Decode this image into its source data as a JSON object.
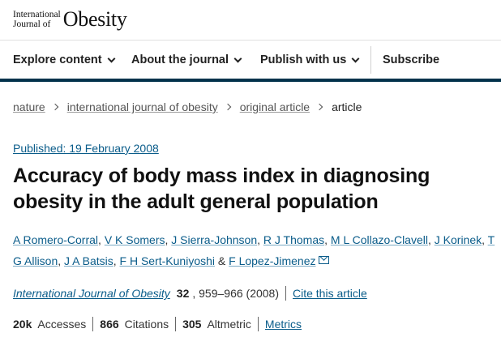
{
  "logo": {
    "small_line1": "International",
    "small_line2": "Journal of",
    "big": "Obesity"
  },
  "nav": {
    "items": [
      {
        "label": "Explore content"
      },
      {
        "label": "About the journal"
      },
      {
        "label": "Publish with us"
      }
    ],
    "subscribe_label": "Subscribe",
    "accent_color": "#01324b"
  },
  "breadcrumb": {
    "items": [
      "nature",
      "international journal of obesity",
      "original article"
    ],
    "current": "article"
  },
  "article": {
    "published": "Published: 19 February 2008",
    "title": "Accuracy of body mass index in diagnosing obesity in the adult general population",
    "authors": [
      "A Romero-Corral",
      "V K Somers",
      "J Sierra-Johnson",
      "R J Thomas",
      "M L Collazo-Clavell",
      "J Korinek",
      "T G Allison",
      "J A Batsis",
      "F H Sert-Kuniyoshi",
      "F Lopez-Jimenez"
    ],
    "author_and": "&",
    "journal": "International Journal of Obesity",
    "volume": "32",
    "pages": ", 959–966 (2008)",
    "cite_label": "Cite this article",
    "link_color": "#0a5c8a"
  },
  "metrics": {
    "accesses_value": "20k",
    "accesses_label": "Accesses",
    "citations_value": "866",
    "citations_label": "Citations",
    "altmetric_value": "305",
    "altmetric_label": "Altmetric",
    "metrics_link": "Metrics"
  },
  "icons": {
    "email": "mail-icon",
    "chevron": "chevron-down-icon"
  }
}
